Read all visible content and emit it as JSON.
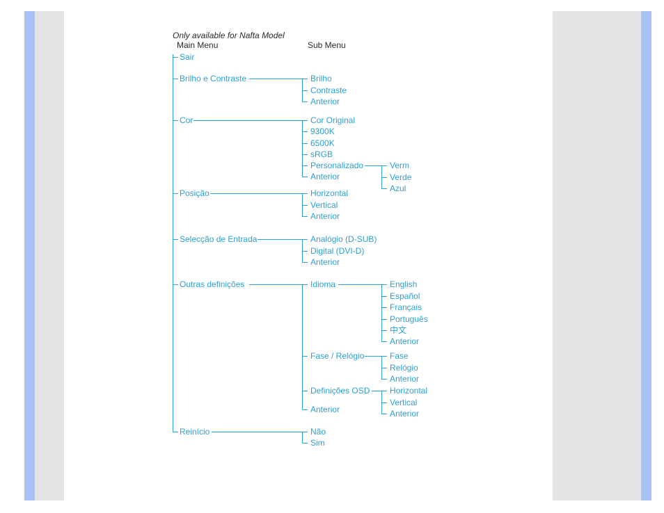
{
  "note": "Only available for Nafta Model",
  "headers": {
    "main": "Main Menu",
    "sub": "Sub Menu"
  },
  "main": {
    "sair": "Sair",
    "brilho": "Brilho e Contraste",
    "cor": "Cor",
    "posicao": "Posição",
    "entrada": "Selecção de Entrada",
    "outras": "Outras definições",
    "reinicio": "Reinício"
  },
  "sub": {
    "brilho": {
      "i0": "Brilho",
      "i1": "Contraste",
      "i2": "Anterior"
    },
    "cor": {
      "i0": "Cor Original",
      "i1": "9300K",
      "i2": "6500K",
      "i3": "sRGB",
      "i4": "Personalizado",
      "i5": "Anterior"
    },
    "cor_rgb": {
      "r": "Verm",
      "g": "Verde",
      "b": "Azul"
    },
    "posicao": {
      "i0": "Horizontal",
      "i1": "Vertical",
      "i2": "Anterior"
    },
    "entrada": {
      "i0": "Analógio (D-SUB)",
      "i1": "Digital (DVI-D)",
      "i2": "Anterior"
    },
    "outras": {
      "i0": "Idioma",
      "i1": "Fase / Relógio",
      "i2": "Definições OSD",
      "i3": "Anterior"
    },
    "idioma": {
      "i0": "English",
      "i1": "Español",
      "i2": "Français",
      "i3": "Português",
      "i4": "中文",
      "i5": "Anterior"
    },
    "fase": {
      "i0": "Fase",
      "i1": "Relógio",
      "i2": "Anterior"
    },
    "osd": {
      "i0": "Horizontal",
      "i1": "Vertical",
      "i2": "Anterior"
    },
    "reinicio": {
      "i0": "Não",
      "i1": "Sim"
    }
  }
}
